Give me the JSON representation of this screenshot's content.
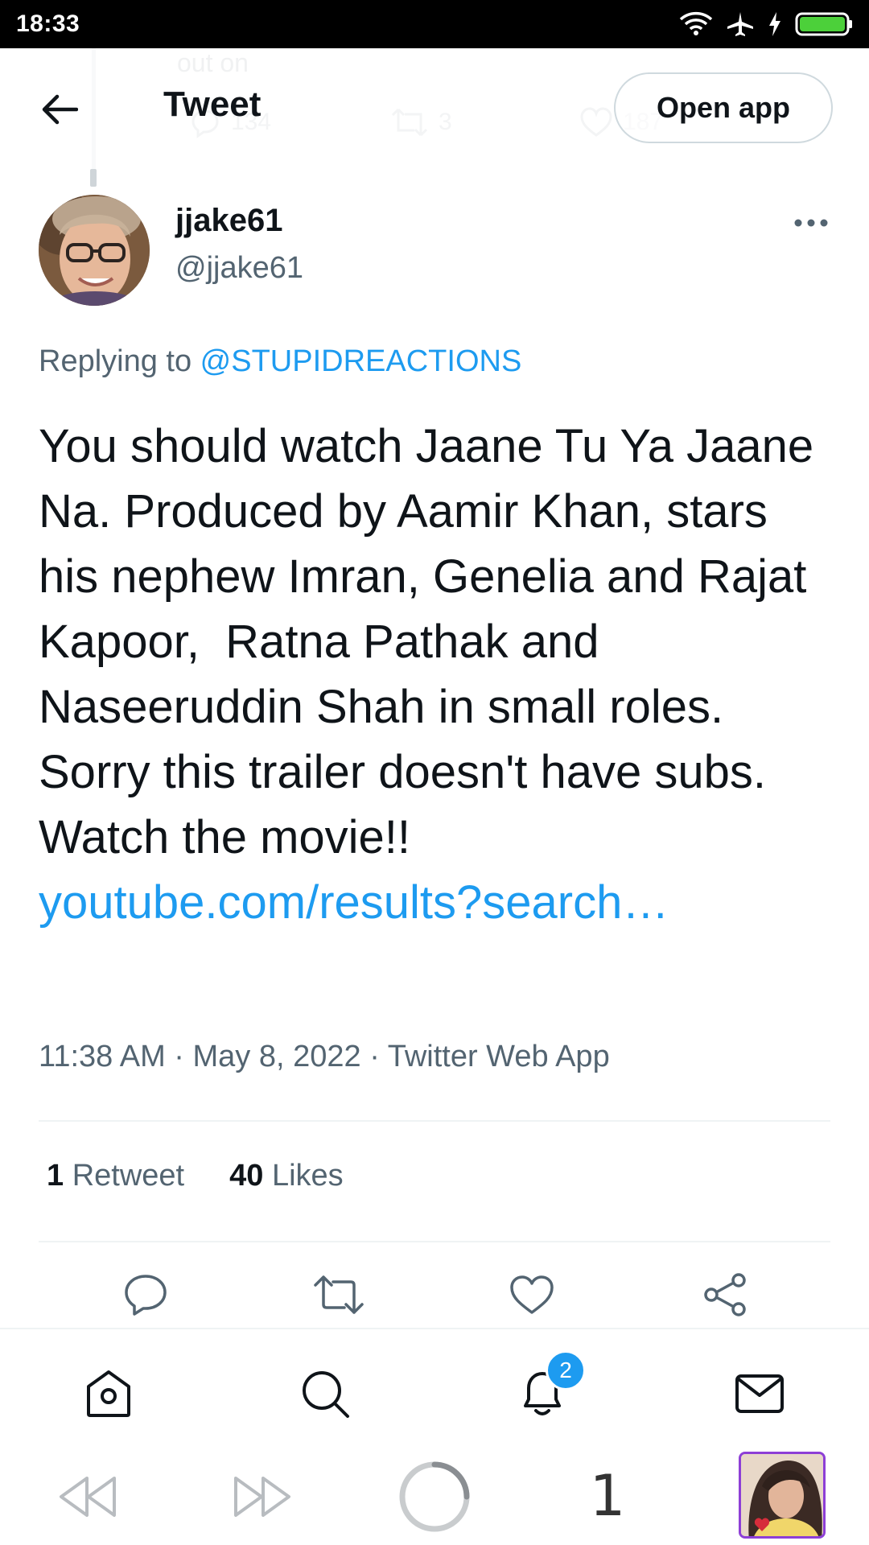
{
  "status_bar": {
    "time": "18:33"
  },
  "header": {
    "title": "Tweet",
    "open_app_label": "Open app",
    "ghost_text": "out on",
    "ghost_counts": {
      "replies": "134",
      "retweets": "3",
      "likes": "187"
    }
  },
  "tweet": {
    "author_name": "jjake61",
    "author_handle": "@jjake61",
    "replying_prefix": "Replying to ",
    "replying_to": "@STUPIDREACTIONS",
    "text": "You should watch Jaane Tu Ya Jaane Na. Produced by Aamir Khan, stars his nephew Imran, Genelia and Rajat Kapoor,  Ratna Pathak and Naseeruddin Shah in small roles. Sorry this trailer doesn't have subs. Watch the movie!! ",
    "link": "youtube.com/results?search…",
    "meta": "11:38 AM · May 8, 2022 · Twitter Web App",
    "retweet_count": "1",
    "retweet_label": "Retweet",
    "like_count": "40",
    "like_label": "Likes"
  },
  "tabbar": {
    "notification_badge": "2"
  },
  "browser_nav": {
    "tab_count": "1"
  },
  "colors": {
    "accent": "#1d9bf0",
    "text": "#0f1419",
    "secondary": "#536471",
    "divider": "#eff3f4"
  }
}
